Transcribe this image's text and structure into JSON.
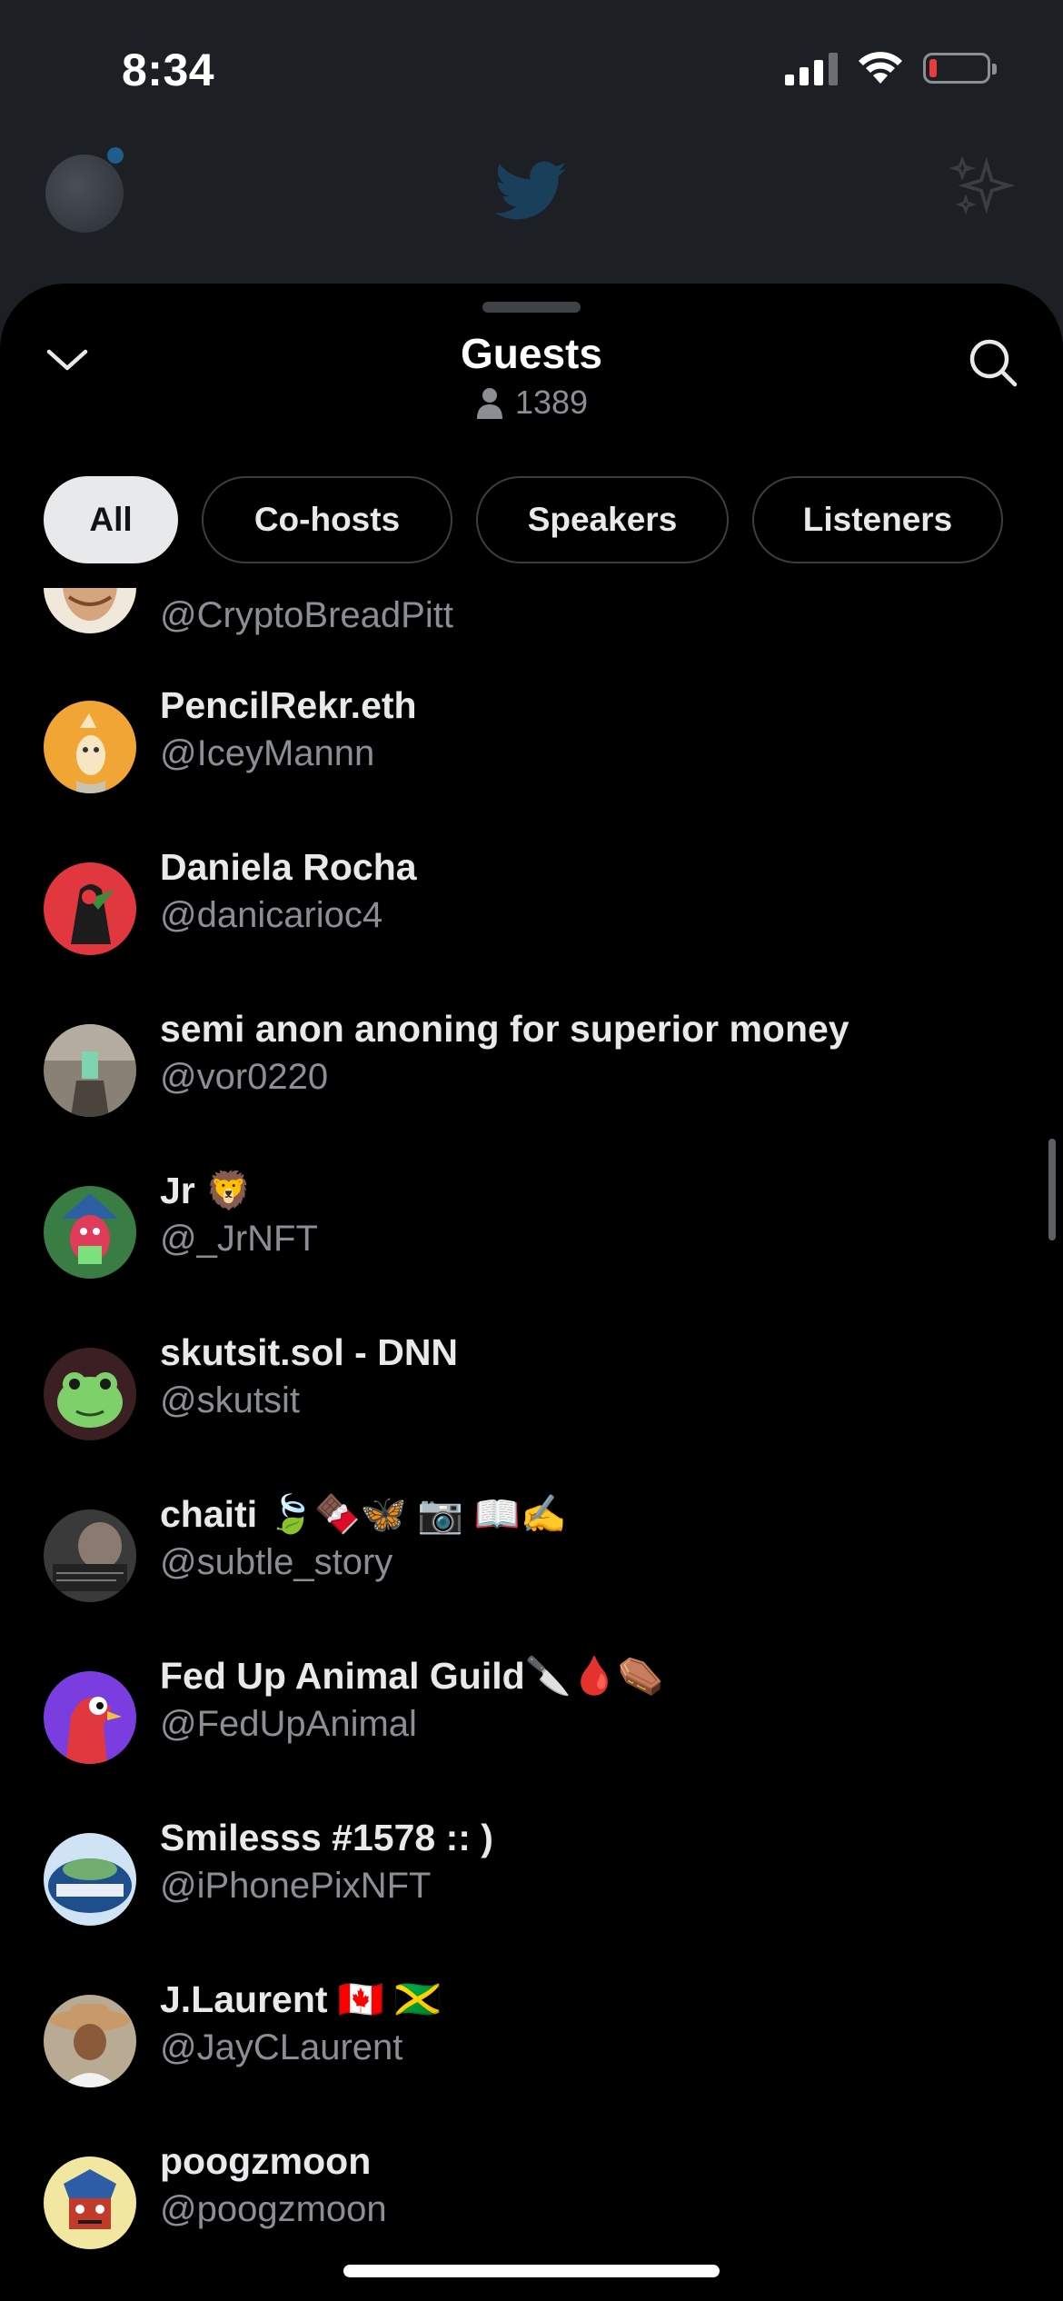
{
  "status_bar": {
    "time": "8:34",
    "battery_color": "#eb3b3b"
  },
  "background": {
    "logo_icon": "twitter-bird-icon",
    "sparkle_icon": "sparkle-icon"
  },
  "sheet": {
    "title": "Guests",
    "guest_count": "1389",
    "collapse_icon": "chevron-down-icon",
    "search_icon": "search-icon",
    "person_icon": "person-icon"
  },
  "tabs": [
    {
      "label": "All",
      "active": true
    },
    {
      "label": "Co-hosts",
      "active": false
    },
    {
      "label": "Speakers",
      "active": false
    },
    {
      "label": "Listeners",
      "active": false
    }
  ],
  "guests": [
    {
      "name": "",
      "handle": "@CryptoBreadPitt",
      "avatar_color": "#d9b38c"
    },
    {
      "name": "PencilRekr.eth",
      "handle": "@IceyMannn",
      "avatar_color": "#f0a534"
    },
    {
      "name": "Daniela Rocha",
      "handle": "@danicarioc4",
      "avatar_color": "#e0383e"
    },
    {
      "name": "semi anon anoning for superior money",
      "handle": "@vor0220",
      "avatar_color": "#6b6258"
    },
    {
      "name": "Jr 🦁",
      "handle": "@_JrNFT",
      "avatar_color": "#3a7d44"
    },
    {
      "name": "skutsit.sol - DNN",
      "handle": "@skutsit",
      "avatar_color": "#3c1f22"
    },
    {
      "name": "chaiti 🍃🍫🦋 📷 📖✍️",
      "handle": "@subtle_story",
      "avatar_color": "#4a4a4a"
    },
    {
      "name": "Fed Up Animal Guild🔪🩸⚰️",
      "handle": "@FedUpAnimal",
      "avatar_color": "#7a3ee0"
    },
    {
      "name": "Smilesss #1578 :: )",
      "handle": "@iPhonePixNFT",
      "avatar_color": "#1e4f8c"
    },
    {
      "name": "J.Laurent 🇨🇦 🇯🇲",
      "handle": "@JayCLaurent",
      "avatar_color": "#c89a6a"
    },
    {
      "name": "poogzmoon",
      "handle": "@poogzmoon",
      "avatar_color": "#f2e7a0"
    }
  ]
}
